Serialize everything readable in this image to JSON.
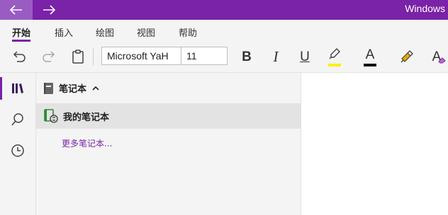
{
  "window": {
    "title": "Windows",
    "accent_color": "#7a22a8"
  },
  "titlebar": {
    "back_icon": "arrow-left-icon",
    "forward_icon": "arrow-right-icon"
  },
  "ribbon": {
    "tabs": [
      {
        "label": "开始",
        "active": true
      },
      {
        "label": "插入",
        "active": false
      },
      {
        "label": "绘图",
        "active": false
      },
      {
        "label": "视图",
        "active": false
      },
      {
        "label": "帮助",
        "active": false
      }
    ],
    "toolbar": {
      "undo_icon": "undo-icon",
      "redo_icon": "redo-icon",
      "clipboard_icon": "clipboard-icon",
      "font_name": "Microsoft YaH",
      "font_size": "11",
      "bold_label": "B",
      "italic_label": "I",
      "underline_label": "U",
      "highlight_icon": "highlighter-icon",
      "highlight_color": "#ffef00",
      "font_color_label": "A",
      "font_color": "#111111",
      "format_painter_icon": "format-painter-icon",
      "clear_format_label": "A",
      "clear_format_icon": "eraser-icon"
    }
  },
  "nav": {
    "items": [
      {
        "icon": "notebooks-icon",
        "active": true
      },
      {
        "icon": "search-icon",
        "active": false
      },
      {
        "icon": "recent-clock-icon",
        "active": false
      }
    ]
  },
  "notebooks": {
    "header": "笔记本",
    "header_icon": "notebook-icon",
    "collapse_icon": "chevron-up-icon",
    "items": [
      {
        "label": "我的笔记本",
        "icon": "sync-notebook-icon",
        "selected": true
      }
    ],
    "more_link": "更多笔记本..."
  }
}
